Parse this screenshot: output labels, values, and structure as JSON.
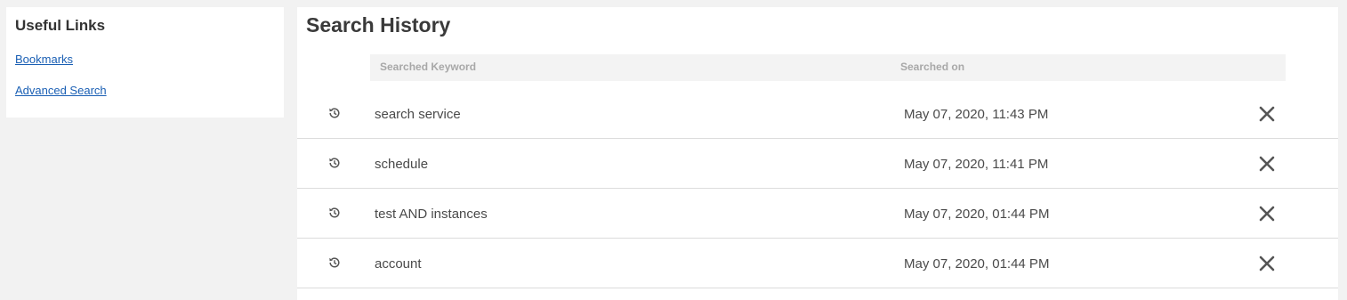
{
  "sidebar": {
    "title": "Useful Links",
    "links": [
      {
        "label": "Bookmarks"
      },
      {
        "label": "Advanced Search"
      }
    ]
  },
  "main": {
    "title": "Search History",
    "columns": {
      "keyword": "Searched Keyword",
      "date": "Searched on"
    },
    "rows": [
      {
        "keyword": "search service",
        "date": "May 07, 2020, 11:43 PM"
      },
      {
        "keyword": "schedule",
        "date": "May 07, 2020, 11:41 PM"
      },
      {
        "keyword": "test AND instances",
        "date": "May 07, 2020, 01:44 PM"
      },
      {
        "keyword": "account",
        "date": "May 07, 2020, 01:44 PM"
      }
    ]
  },
  "icons": {
    "row_icon": "history-icon",
    "delete_icon": "close-icon"
  },
  "colors": {
    "link": "#1a5fb4",
    "background": "#f2f2f2",
    "header_bg": "#f3f3f3"
  }
}
